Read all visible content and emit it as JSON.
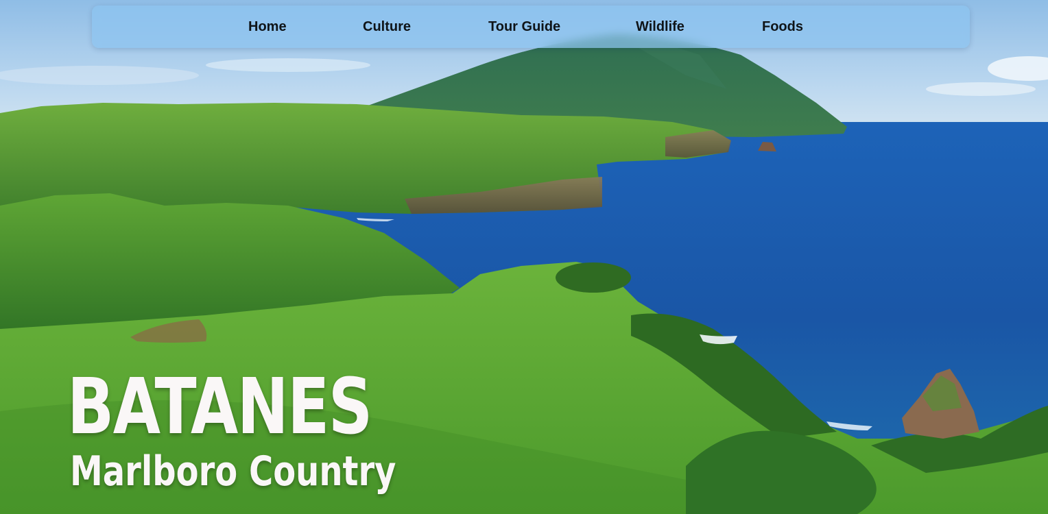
{
  "nav": {
    "items": [
      {
        "label": "Home"
      },
      {
        "label": "Culture"
      },
      {
        "label": "Tour Guide"
      },
      {
        "label": "Wildlife"
      },
      {
        "label": "Foods"
      }
    ]
  },
  "hero": {
    "title": "BATANES",
    "subtitle": "Marlboro Country",
    "image_icon": "landscape-photo-icon"
  },
  "colors": {
    "navbar_bg": "#8cc3f0",
    "nav_text": "#0f1418",
    "hero_text": "#faf7f7",
    "sea": "#1e5fb0",
    "grass": "#4a9a2e",
    "sky": "#a9cfee"
  }
}
